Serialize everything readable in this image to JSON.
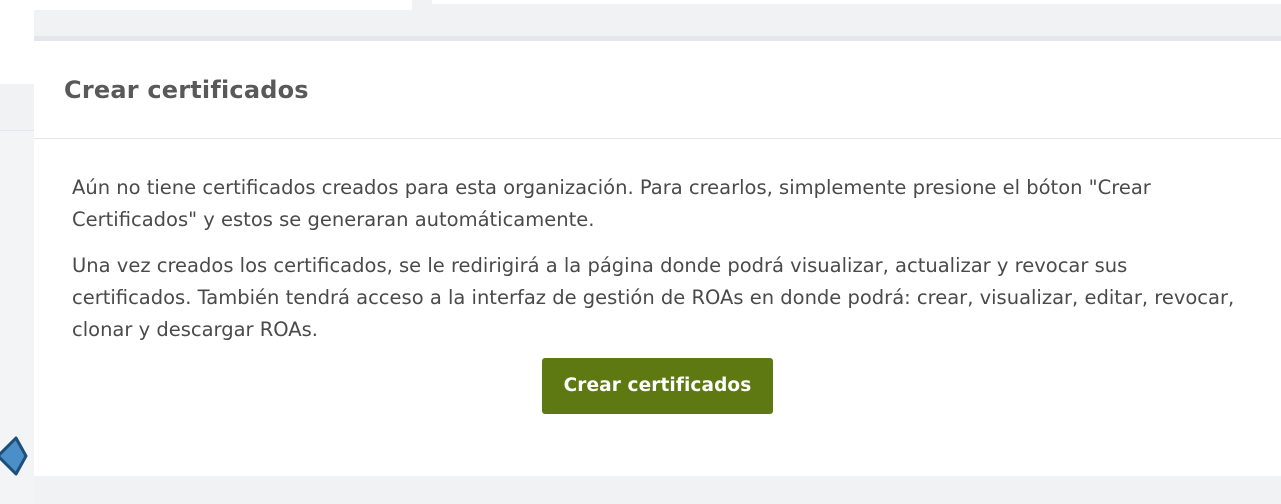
{
  "card": {
    "title": "Crear certificados",
    "paragraphs": [
      "Aún no tiene certificados creados para esta organización. Para crearlos, simplemente presione el bóton \"Crear Certificados\" y estos se generaran automáticamente.",
      "Una vez creados los certificados, se le redirigirá a la página donde podrá visualizar, actualizar y revocar sus certificados. También tendrá acceso a la interfaz de gestión de ROAs en donde podrá: crear, visualizar, editar, revocar, clonar y descargar ROAs."
    ],
    "create_button_label": "Crear certificados"
  },
  "colors": {
    "button": "#5e7911",
    "background": "#f1f2f4",
    "card": "#ffffff",
    "pointer_fill": "#4a8fc7",
    "pointer_stroke": "#1f4e7a"
  },
  "icons": {
    "pointer": "arrow-right-icon"
  }
}
